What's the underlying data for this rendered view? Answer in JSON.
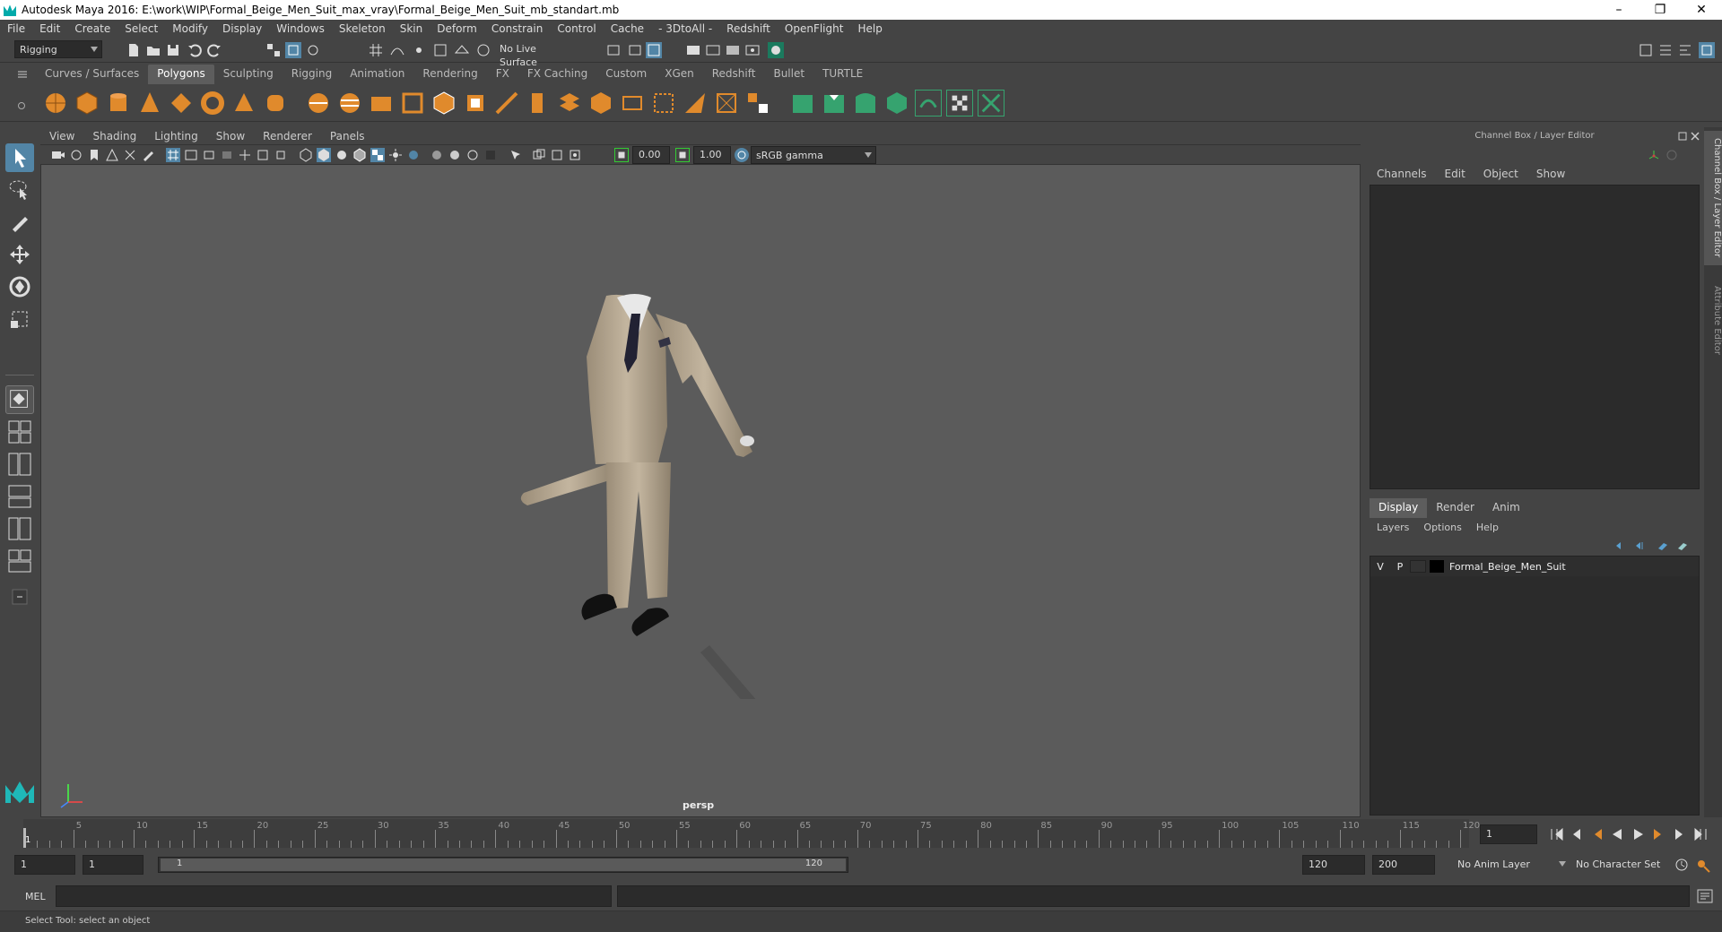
{
  "window": {
    "title": "Autodesk Maya 2016: E:\\work\\WIP\\Formal_Beige_Men_Suit_max_vray\\Formal_Beige_Men_Suit_mb_standart.mb"
  },
  "menubar": [
    "File",
    "Edit",
    "Create",
    "Select",
    "Modify",
    "Display",
    "Windows",
    "Skeleton",
    "Skin",
    "Deform",
    "Constrain",
    "Control",
    "Cache",
    "- 3DtoAll -",
    "Redshift",
    "OpenFlight",
    "Help"
  ],
  "statusline": {
    "mode": "Rigging",
    "live_surface": "No Live Surface"
  },
  "shelf": {
    "tabs": [
      "Curves / Surfaces",
      "Polygons",
      "Sculpting",
      "Rigging",
      "Animation",
      "Rendering",
      "FX",
      "FX Caching",
      "Custom",
      "XGen",
      "Redshift",
      "Bullet",
      "TURTLE"
    ],
    "active": "Polygons"
  },
  "viewport": {
    "menus": [
      "View",
      "Shading",
      "Lighting",
      "Show",
      "Renderer",
      "Panels"
    ],
    "exposure": "0.00",
    "gamma": "1.00",
    "color_space": "sRGB gamma",
    "camera_label": "persp"
  },
  "channel_box": {
    "title": "Channel Box / Layer Editor",
    "menus": [
      "Channels",
      "Edit",
      "Object",
      "Show"
    ]
  },
  "layer_editor": {
    "tabs": [
      "Display",
      "Render",
      "Anim"
    ],
    "active_tab": "Display",
    "menus": [
      "Layers",
      "Options",
      "Help"
    ],
    "layers": [
      {
        "v": "V",
        "p": "P",
        "name": "Formal_Beige_Men_Suit"
      }
    ]
  },
  "side_tabs": [
    "Channel Box / Layer Editor",
    "Attribute Editor"
  ],
  "timeline": {
    "ticks": [
      "5",
      "10",
      "15",
      "20",
      "25",
      "30",
      "35",
      "40",
      "45",
      "50",
      "55",
      "60",
      "65",
      "70",
      "75",
      "80",
      "85",
      "90",
      "95",
      "100",
      "105",
      "110",
      "115",
      "120"
    ],
    "start_marker": "1",
    "current_frame": "1"
  },
  "range": {
    "start": "1",
    "anim_start": "1",
    "slider_start": "1",
    "slider_end": "120",
    "anim_end": "120",
    "end": "200",
    "anim_layer": "No Anim Layer",
    "character_set": "No Character Set"
  },
  "command_line": {
    "label": "MEL"
  },
  "help_line": {
    "text": "Select Tool: select an object"
  },
  "colors": {
    "accent": "#5285a6",
    "shelf_orange": "#e08a2c",
    "shelf_green": "#36a36f",
    "suit": "#b5a690"
  }
}
